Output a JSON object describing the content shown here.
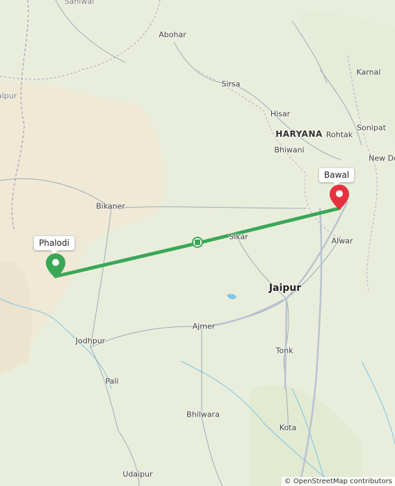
{
  "map": {
    "places": [
      {
        "id": "sahiwal",
        "name": "Sahiwal",
        "style": "faint"
      },
      {
        "id": "abohar",
        "name": "Abohar",
        "style": ""
      },
      {
        "id": "karnal",
        "name": "Karnal",
        "style": ""
      },
      {
        "id": "alpur",
        "name": "alpur",
        "style": "faint"
      },
      {
        "id": "sirsa",
        "name": "Sirsa",
        "style": ""
      },
      {
        "id": "hisar",
        "name": "Hisar",
        "style": ""
      },
      {
        "id": "sonipat",
        "name": "Sonipat",
        "style": ""
      },
      {
        "id": "haryana",
        "name": "HARYANA",
        "style": "state"
      },
      {
        "id": "rohtak",
        "name": "Rohtak",
        "style": ""
      },
      {
        "id": "bhiwani",
        "name": "Bhiwani",
        "style": ""
      },
      {
        "id": "newdelhi",
        "name": "New Del",
        "style": ""
      },
      {
        "id": "bikaner",
        "name": "Bikaner",
        "style": ""
      },
      {
        "id": "sikar",
        "name": "Sikar",
        "style": ""
      },
      {
        "id": "alwar",
        "name": "Alwar",
        "style": ""
      },
      {
        "id": "jaipur",
        "name": "Jaipur",
        "style": "big"
      },
      {
        "id": "ajmer",
        "name": "Ajmer",
        "style": ""
      },
      {
        "id": "jodhpur",
        "name": "Jodhpur",
        "style": ""
      },
      {
        "id": "tonk",
        "name": "Tonk",
        "style": ""
      },
      {
        "id": "pali",
        "name": "Pali",
        "style": ""
      },
      {
        "id": "bhilwara",
        "name": "Bhilwara",
        "style": ""
      },
      {
        "id": "kota",
        "name": "Kota",
        "style": ""
      },
      {
        "id": "udaipur",
        "name": "Udaipur",
        "style": ""
      }
    ],
    "route": {
      "start_label": "Phalodi",
      "end_label": "Bawal",
      "color": "#3aa757",
      "end_pin_color": "#e8313f",
      "start_pin_color": "#3aa757"
    },
    "attribution": "© OpenStreetMap contributors",
    "colors": {
      "land": "#e9eedc",
      "desert": "#efe9d6",
      "water": "#6fc3e8",
      "road": "#7d8fa8",
      "border": "#9a8aa8"
    }
  }
}
